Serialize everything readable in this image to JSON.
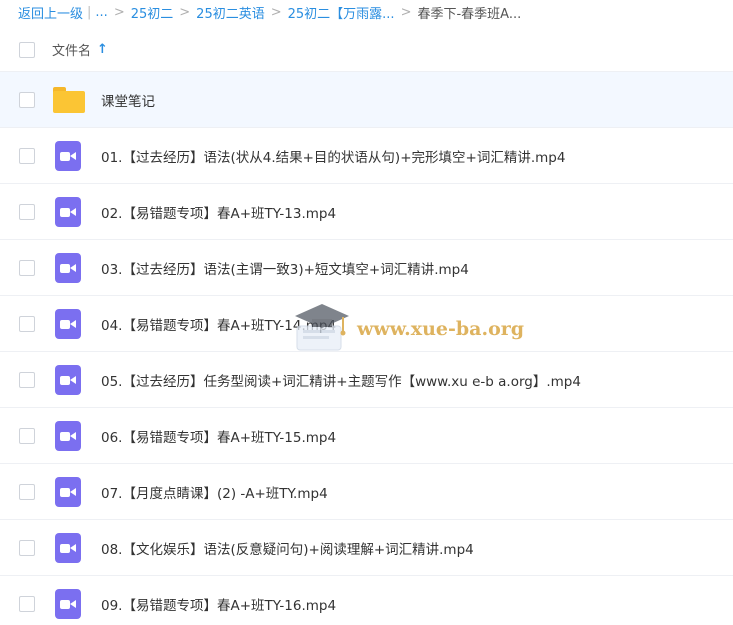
{
  "breadcrumb": {
    "back": "返回上一级",
    "bar": "|",
    "ellipsis": "...",
    "sep": ">",
    "items": [
      "25初二",
      "25初二英语",
      "25初二【万雨露..."
    ],
    "current": "春季下-春季班A..."
  },
  "header": {
    "column_label": "文件名",
    "sort_arrow": "↑"
  },
  "rows": [
    {
      "name": "课堂笔记",
      "type": "folder"
    },
    {
      "name": "01.【过去经历】语法(状从4.结果+目的状语从句)+完形填空+词汇精讲.mp4",
      "type": "video"
    },
    {
      "name": "02.【易错题专项】春A+班TY-13.mp4",
      "type": "video"
    },
    {
      "name": "03.【过去经历】语法(主谓一致3)+短文填空+词汇精讲.mp4",
      "type": "video"
    },
    {
      "name": "04.【易错题专项】春A+班TY-14.mp4",
      "type": "video"
    },
    {
      "name": "05.【过去经历】任务型阅读+词汇精讲+主题写作【www.xu e-b a.org】.mp4",
      "type": "video"
    },
    {
      "name": "06.【易错题专项】春A+班TY-15.mp4",
      "type": "video"
    },
    {
      "name": "07.【月度点睛课】(2) -A+班TY.mp4",
      "type": "video"
    },
    {
      "name": "08.【文化娱乐】语法(反意疑问句)+阅读理解+词汇精讲.mp4",
      "type": "video"
    },
    {
      "name": "09.【易错题专项】春A+班TY-16.mp4",
      "type": "video"
    }
  ],
  "watermark": {
    "text": "www.xue-ba.org"
  },
  "colors": {
    "link": "#2a8ee0",
    "folder": "#fbc534",
    "video": "#7b6ff0",
    "highlight_row": "#f3f8ff"
  },
  "icons": {
    "folder": "folder-icon",
    "video": "video-file-icon",
    "sort": "arrow-up-icon",
    "watermark": "graduation-cap-icon"
  }
}
